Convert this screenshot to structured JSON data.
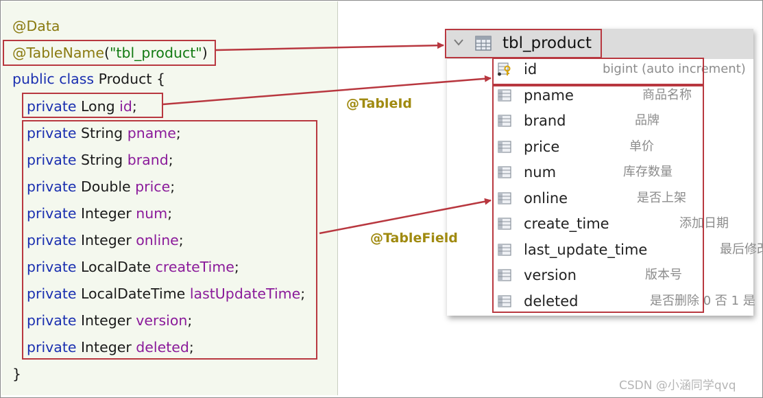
{
  "code": {
    "data_annotation": "@Data",
    "tablename_annotation": "@TableName",
    "tablename_open": "(",
    "tablename_value": "\"tbl_product\"",
    "tablename_close": ")",
    "class_keyword": "public class",
    "class_rest": " Product {",
    "private_kw": "private",
    "fields": [
      {
        "type": " Long ",
        "name": "id"
      },
      {
        "type": " String ",
        "name": "pname"
      },
      {
        "type": " String ",
        "name": "brand"
      },
      {
        "type": " Double ",
        "name": "price"
      },
      {
        "type": " Integer ",
        "name": "num"
      },
      {
        "type": " Integer ",
        "name": "online"
      },
      {
        "type": " LocalDate ",
        "name": "createTime"
      },
      {
        "type": " LocalDateTime ",
        "name": "lastUpdateTime"
      },
      {
        "type": " Integer ",
        "name": "version"
      },
      {
        "type": " Integer ",
        "name": "deleted"
      }
    ],
    "semicolon": ";",
    "closing_brace": "}"
  },
  "table": {
    "name": "tbl_product",
    "columns": [
      {
        "name": "id",
        "comment": "bigint (auto increment)"
      },
      {
        "name": "pname",
        "comment": "商品名称"
      },
      {
        "name": "brand",
        "comment": "品牌"
      },
      {
        "name": "price",
        "comment": "单价"
      },
      {
        "name": "num",
        "comment": "库存数量"
      },
      {
        "name": "online",
        "comment": "是否上架"
      },
      {
        "name": "create_time",
        "comment": "添加日期"
      },
      {
        "name": "last_update_time",
        "comment": "最后修改日期"
      },
      {
        "name": "version",
        "comment": "版本号"
      },
      {
        "name": "deleted",
        "comment": "是否删除 0 否 1 是"
      }
    ]
  },
  "labels": {
    "table_id": "@TableId",
    "table_field": "@TableField"
  },
  "watermark": "CSDN @小涵同学qvq",
  "colors": {
    "box_red": "#b8373f",
    "keyword_blue": "#1a2fb0",
    "field_purple": "#8a1a9a",
    "annotation_gold": "#a08a10"
  }
}
